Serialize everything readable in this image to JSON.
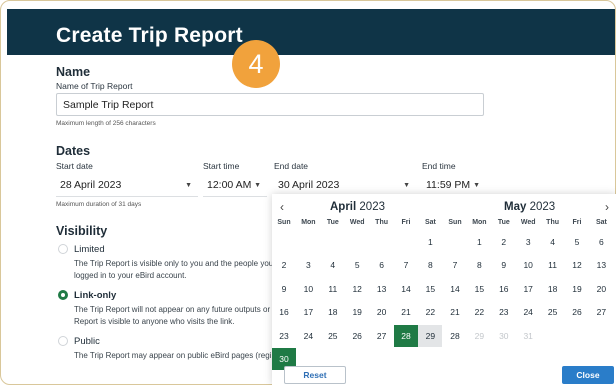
{
  "header": {
    "title": "Create Trip Report",
    "step_badge": "4"
  },
  "name_section": {
    "heading": "Name",
    "label": "Name of Trip Report",
    "value": "Sample Trip Report",
    "hint": "Maximum length of 256 characters"
  },
  "dates_section": {
    "heading": "Dates",
    "start_date_label": "Start date",
    "start_date_value": "28 April 2023",
    "start_time_label": "Start time",
    "start_time_value": "12:00 AM",
    "end_date_label": "End date",
    "end_date_value": "30 April 2023",
    "end_time_label": "End time",
    "end_time_value": "11:59 PM",
    "hint": "Maximum duration of 31 days"
  },
  "visibility_section": {
    "heading": "Visibility",
    "options": [
      {
        "label": "Limited",
        "desc": "The Trip Report is visible only to you and the people you",
        "desc2": "logged in to your eBird account.",
        "selected": false
      },
      {
        "label": "Link-only",
        "desc": "The Trip Report will not appear on any future outputs or",
        "desc2": "Report is visible to anyone who visits the link.",
        "selected": true
      },
      {
        "label": "Public",
        "desc": "The Trip Report may appear on public eBird pages (regi",
        "desc2": "",
        "selected": false
      }
    ]
  },
  "calendar": {
    "prev_icon": "‹",
    "next_icon": "›",
    "weekdays": [
      "Sun",
      "Mon",
      "Tue",
      "Wed",
      "Thu",
      "Fri",
      "Sat"
    ],
    "months": [
      {
        "name": "April",
        "year": "2023",
        "days": [
          {
            "d": "1",
            "col": 6,
            "row": 0
          },
          {
            "d": "2",
            "col": 0,
            "row": 1
          },
          {
            "d": "3",
            "col": 1,
            "row": 1
          },
          {
            "d": "4",
            "col": 2,
            "row": 1
          },
          {
            "d": "5",
            "col": 3,
            "row": 1
          },
          {
            "d": "6",
            "col": 4,
            "row": 1
          },
          {
            "d": "7",
            "col": 5,
            "row": 1
          },
          {
            "d": "8",
            "col": 6,
            "row": 1
          },
          {
            "d": "9",
            "col": 0,
            "row": 2
          },
          {
            "d": "10",
            "col": 1,
            "row": 2
          },
          {
            "d": "11",
            "col": 2,
            "row": 2
          },
          {
            "d": "12",
            "col": 3,
            "row": 2
          },
          {
            "d": "13",
            "col": 4,
            "row": 2
          },
          {
            "d": "14",
            "col": 5,
            "row": 2
          },
          {
            "d": "15",
            "col": 6,
            "row": 2
          },
          {
            "d": "16",
            "col": 0,
            "row": 3
          },
          {
            "d": "17",
            "col": 1,
            "row": 3
          },
          {
            "d": "18",
            "col": 2,
            "row": 3
          },
          {
            "d": "19",
            "col": 3,
            "row": 3
          },
          {
            "d": "20",
            "col": 4,
            "row": 3
          },
          {
            "d": "21",
            "col": 5,
            "row": 3
          },
          {
            "d": "22",
            "col": 6,
            "row": 3
          },
          {
            "d": "23",
            "col": 0,
            "row": 4
          },
          {
            "d": "24",
            "col": 1,
            "row": 4
          },
          {
            "d": "25",
            "col": 2,
            "row": 4
          },
          {
            "d": "26",
            "col": 3,
            "row": 4
          },
          {
            "d": "27",
            "col": 4,
            "row": 4
          },
          {
            "d": "28",
            "col": 5,
            "row": 4,
            "state": "sel"
          },
          {
            "d": "29",
            "col": 6,
            "row": 4,
            "state": "range"
          },
          {
            "d": "30",
            "col": 0,
            "row": 5,
            "state": "sel"
          }
        ]
      },
      {
        "name": "May",
        "year": "2023",
        "days": [
          {
            "d": "1",
            "col": 1,
            "row": 0
          },
          {
            "d": "2",
            "col": 2,
            "row": 0
          },
          {
            "d": "3",
            "col": 3,
            "row": 0
          },
          {
            "d": "4",
            "col": 4,
            "row": 0
          },
          {
            "d": "5",
            "col": 5,
            "row": 0
          },
          {
            "d": "6",
            "col": 6,
            "row": 0
          },
          {
            "d": "7",
            "col": 0,
            "row": 1
          },
          {
            "d": "8",
            "col": 1,
            "row": 1
          },
          {
            "d": "9",
            "col": 2,
            "row": 1
          },
          {
            "d": "10",
            "col": 3,
            "row": 1
          },
          {
            "d": "11",
            "col": 4,
            "row": 1
          },
          {
            "d": "12",
            "col": 5,
            "row": 1
          },
          {
            "d": "13",
            "col": 6,
            "row": 1
          },
          {
            "d": "14",
            "col": 0,
            "row": 2
          },
          {
            "d": "15",
            "col": 1,
            "row": 2
          },
          {
            "d": "16",
            "col": 2,
            "row": 2
          },
          {
            "d": "17",
            "col": 3,
            "row": 2
          },
          {
            "d": "18",
            "col": 4,
            "row": 2
          },
          {
            "d": "19",
            "col": 5,
            "row": 2
          },
          {
            "d": "20",
            "col": 6,
            "row": 2
          },
          {
            "d": "21",
            "col": 0,
            "row": 3
          },
          {
            "d": "22",
            "col": 1,
            "row": 3
          },
          {
            "d": "23",
            "col": 2,
            "row": 3
          },
          {
            "d": "24",
            "col": 3,
            "row": 3
          },
          {
            "d": "25",
            "col": 4,
            "row": 3
          },
          {
            "d": "26",
            "col": 5,
            "row": 3
          },
          {
            "d": "27",
            "col": 6,
            "row": 3
          },
          {
            "d": "28",
            "col": 0,
            "row": 4
          },
          {
            "d": "29",
            "col": 1,
            "row": 4,
            "state": "muted"
          },
          {
            "d": "30",
            "col": 2,
            "row": 4,
            "state": "muted"
          },
          {
            "d": "31",
            "col": 3,
            "row": 4,
            "state": "muted"
          }
        ]
      }
    ],
    "reset_label": "Reset",
    "close_label": "Close"
  },
  "colors": {
    "header": "#0f3447",
    "badge": "#f1a23c",
    "selected": "#1f7a45",
    "primary_button": "#2a7dc9"
  }
}
